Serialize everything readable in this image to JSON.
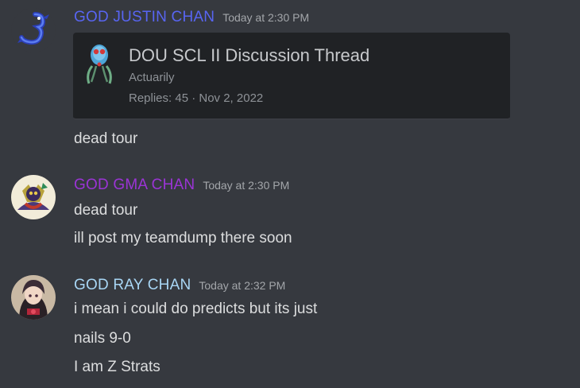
{
  "colors": {
    "background": "#36393f",
    "user1": "#5865f2",
    "user2": "#9b34d6",
    "user3": "#a8d6f5"
  },
  "messages": [
    {
      "username": "GOD JUSTIN CHAN",
      "timestamp": "Today at 2:30 PM",
      "avatar_icon": "blue-dragon-avatar",
      "embed": {
        "icon": "tentacool-icon",
        "title": "DOU SCL II Discussion Thread",
        "author": "Actuarily",
        "meta": "Replies: 45 · Nov 2, 2022"
      },
      "lines": [
        "dead tour"
      ]
    },
    {
      "username": "GOD GMA CHAN",
      "timestamp": "Today at 2:30 PM",
      "avatar_icon": "creature-avatar",
      "lines": [
        "dead tour",
        "ill post my teamdump there soon"
      ]
    },
    {
      "username": "GOD RAY CHAN",
      "timestamp": "Today at 2:32 PM",
      "avatar_icon": "anime-character-avatar",
      "lines": [
        "i mean i could do predicts but its just",
        "nails 9-0",
        "I am Z Strats"
      ]
    }
  ]
}
